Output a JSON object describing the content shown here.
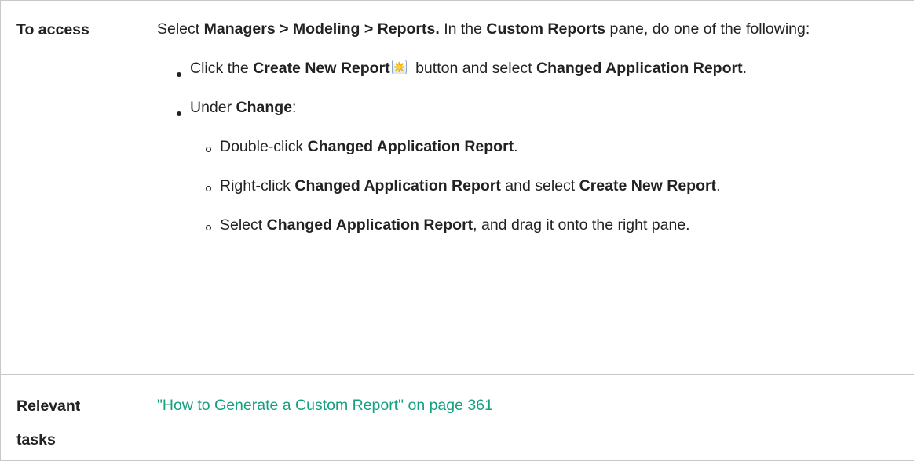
{
  "row_access": {
    "label": "To access",
    "intro": {
      "t1": "Select ",
      "b1": "Managers > Modeling > Reports.",
      "t2": " In the ",
      "b2": "Custom Reports",
      "t3": " pane, do one of the following:"
    },
    "bullet1": {
      "t1": "Click the ",
      "b1": "Create New Report",
      "t2": " button and select ",
      "b2": "Changed Application Report",
      "t3": "."
    },
    "bullet2": {
      "t1": "Under ",
      "b1": "Change",
      "t2": ":"
    },
    "sub1": {
      "t1": "Double-click ",
      "b1": "Changed Application Report",
      "t2": "."
    },
    "sub2": {
      "t1": "Right-click ",
      "b1": "Changed Application Report",
      "t2": " and select ",
      "b2": "Create New Report",
      "t3": "."
    },
    "sub3": {
      "t1": "Select ",
      "b1": "Changed Application Report",
      "t2": ", and drag it onto the right pane."
    }
  },
  "row_tasks": {
    "label_line1": "Relevant",
    "label_line2": "tasks",
    "link_text": "\"How to Generate a Custom Report\" on page 361"
  },
  "icons": {
    "create_new_report": "create-new-report-icon"
  },
  "colors": {
    "link": "#15a07f",
    "border": "#c8c8c8",
    "text": "#222222"
  }
}
